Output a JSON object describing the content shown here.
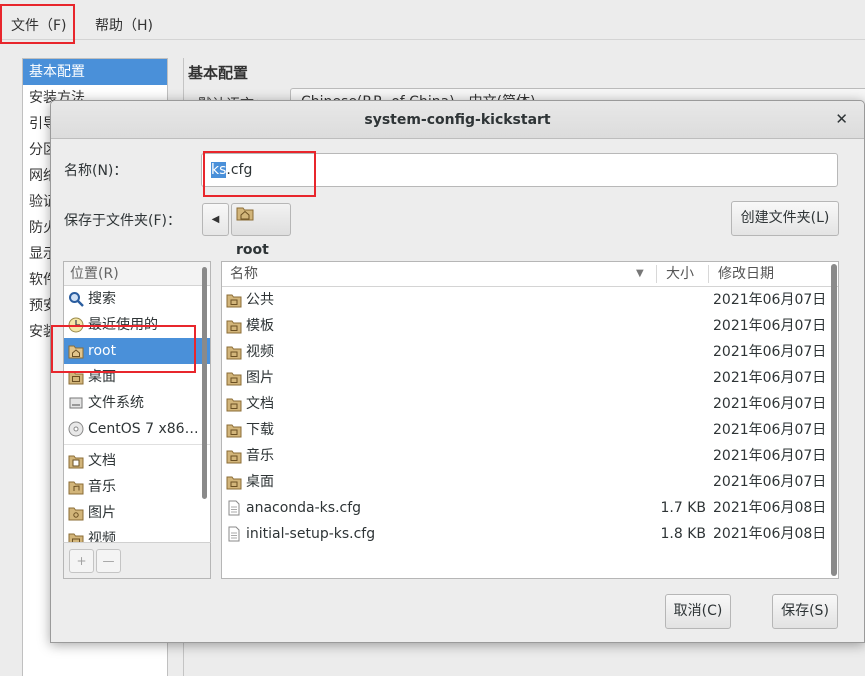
{
  "menubar": {
    "file": "文件（F)",
    "help": "帮助（H)"
  },
  "app": {
    "categories": [
      "基本配置",
      "安装方法",
      "引导",
      "分区",
      "网络",
      "验证",
      "防火",
      "显示",
      "软件",
      "预安",
      "安装"
    ],
    "section_title": "基本配置",
    "default_language_label": "默认语言：",
    "default_language_value": "Chinese(P.R. of China) - 中文(简体)"
  },
  "dialog": {
    "title": "system-config-kickstart",
    "name_label": "名称(N)：",
    "filename_selected": "ks",
    "filename_rest": ".cfg",
    "folder_label": "保存于文件夹(F)：",
    "path_current": "root",
    "create_folder": "创建文件夹(L)",
    "places_header": "位置(R)",
    "places": [
      {
        "label": "搜索",
        "icon": "search-icon"
      },
      {
        "label": "最近使用的",
        "icon": "clock-icon"
      },
      {
        "label": "root",
        "icon": "home-folder-icon",
        "selected": true
      },
      {
        "label": "桌面",
        "icon": "desktop-folder-icon"
      },
      {
        "label": "文件系统",
        "icon": "drive-icon"
      },
      {
        "label": "CentOS 7 x86…",
        "icon": "disc-icon"
      },
      {
        "label": "文档",
        "icon": "documents-folder-icon"
      },
      {
        "label": "音乐",
        "icon": "music-folder-icon"
      },
      {
        "label": "图片",
        "icon": "pictures-folder-icon"
      },
      {
        "label": "视频",
        "icon": "videos-folder-icon"
      }
    ],
    "add_btn": "+",
    "remove_btn": "—",
    "columns": {
      "name": "名称",
      "size": "大小",
      "date": "修改日期"
    },
    "files": [
      {
        "name": "公共",
        "size": "",
        "date": "2021年06月07日",
        "type": "folder"
      },
      {
        "name": "模板",
        "size": "",
        "date": "2021年06月07日",
        "type": "folder"
      },
      {
        "name": "视频",
        "size": "",
        "date": "2021年06月07日",
        "type": "folder"
      },
      {
        "name": "图片",
        "size": "",
        "date": "2021年06月07日",
        "type": "folder"
      },
      {
        "name": "文档",
        "size": "",
        "date": "2021年06月07日",
        "type": "folder"
      },
      {
        "name": "下载",
        "size": "",
        "date": "2021年06月07日",
        "type": "folder"
      },
      {
        "name": "音乐",
        "size": "",
        "date": "2021年06月07日",
        "type": "folder"
      },
      {
        "name": "桌面",
        "size": "",
        "date": "2021年06月07日",
        "type": "folder"
      },
      {
        "name": "anaconda-ks.cfg",
        "size": "1.7 KB",
        "date": "2021年06月08日",
        "type": "file"
      },
      {
        "name": "initial-setup-ks.cfg",
        "size": "1.8 KB",
        "date": "2021年06月08日",
        "type": "file"
      }
    ],
    "cancel": "取消(C)",
    "save": "保存(S)"
  },
  "colors": {
    "selection": "#4a90d9",
    "highlight_box": "#e8262c",
    "folder": "#c9a86a"
  }
}
